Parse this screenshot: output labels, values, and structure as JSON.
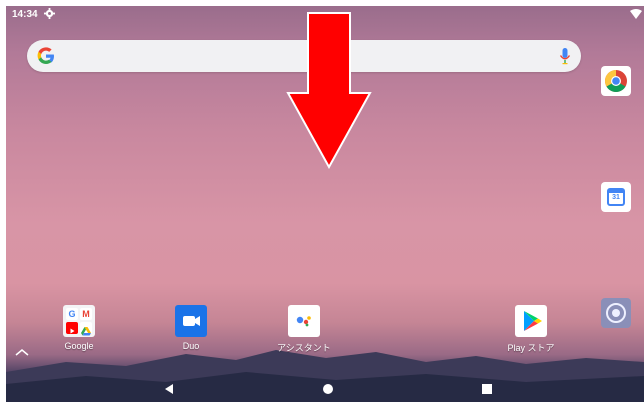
{
  "status_bar": {
    "time": "14:34",
    "settings_icon": "gear-icon",
    "wifi_icon": "wifi-icon"
  },
  "search": {
    "logo": "google-g-icon",
    "mic": "mic-icon"
  },
  "overlay": {
    "arrow": "down-arrow",
    "color": "#ff0000"
  },
  "side_icons": [
    "chrome-icon",
    "calendar-icon",
    "camera-icon"
  ],
  "calendar_day": "31",
  "apps": [
    {
      "label": "Google",
      "icon": "google-folder-icon"
    },
    {
      "label": "Duo",
      "icon": "duo-icon"
    },
    {
      "label": "アシスタント",
      "icon": "assistant-icon"
    },
    {
      "label": "Play ストア",
      "icon": "play-store-icon"
    }
  ],
  "folder": {
    "gmail_letter": "M",
    "google_letter": "G"
  },
  "nav": {
    "back": "back-icon",
    "home": "home-icon",
    "recents": "recents-icon"
  }
}
